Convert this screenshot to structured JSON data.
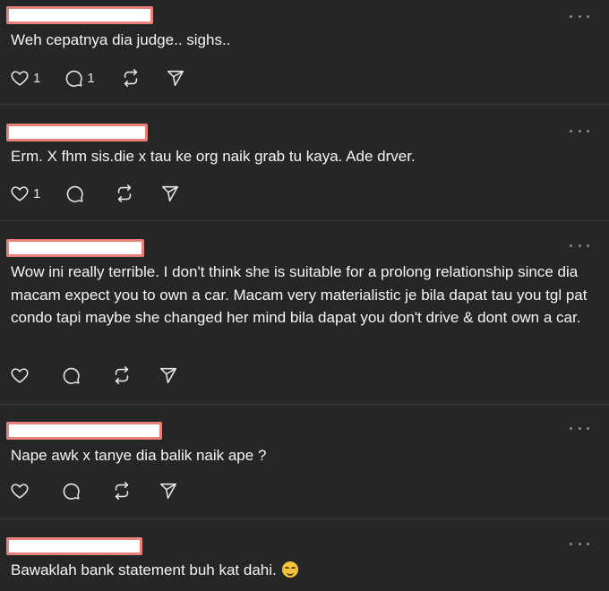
{
  "colors": {
    "background": "#262626",
    "text": "#f3f5f7",
    "redaction_fill": "#ffffff",
    "redaction_border": "#e8807b"
  },
  "icons": {
    "like": "heart-icon",
    "reply": "speech-bubble-icon",
    "repost": "repost-icon",
    "share": "send-icon",
    "menu": "more-options-icon"
  },
  "posts": [
    {
      "text": "Weh cepatnya dia judge.. sighs..",
      "likes": "1",
      "replies": "1"
    },
    {
      "text": "Erm. X fhm sis.die x tau ke org naik grab tu kaya. Ade drver.",
      "likes": "1",
      "replies": ""
    },
    {
      "text": "Wow ini really terrible. I don't think she is suitable for a prolong relationship since dia macam expect you to own a car. Macam very materialistic je bila dapat tau you tgl pat condo tapi maybe she changed her mind bila dapat you don't drive & dont own a car.",
      "likes": "",
      "replies": ""
    },
    {
      "text": "Nape awk x tanye dia balik naik ape ?",
      "likes": "",
      "replies": ""
    },
    {
      "text": "Bawaklah bank statement buh kat dahi.",
      "emoji": "grinning-face-emoji",
      "likes": "",
      "replies": ""
    }
  ]
}
